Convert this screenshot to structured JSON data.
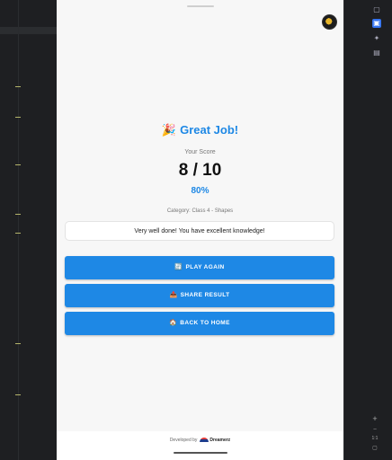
{
  "app": {
    "title_emoji": "🎉",
    "title": "Great Job!",
    "your_score_label": "Your Score",
    "score": "8 / 10",
    "percent": "80%",
    "category": "Category: Class 4 - Shapes",
    "message": "Very well done! You have excellent knowledge!",
    "buttons": [
      {
        "icon": "🔄",
        "label": "PLAY AGAIN"
      },
      {
        "icon": "📤",
        "label": "SHARE RESULT"
      },
      {
        "icon": "🏠",
        "label": "BACK TO HOME"
      }
    ],
    "footer": {
      "prefix": "Developed by",
      "brand": "Dreamerz"
    }
  },
  "ide": {
    "right_tools": [
      "device-icon",
      "layout-inspector-icon",
      "sparkle-icon",
      "file-icon"
    ],
    "zoom": {
      "plus": "+",
      "ratio": "1:1"
    }
  },
  "colors": {
    "accent": "#1e88e5",
    "background": "#f7f7f7"
  }
}
